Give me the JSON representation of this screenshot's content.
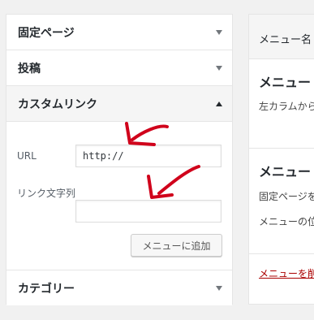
{
  "accordion": {
    "fixed_pages": "固定ページ",
    "posts": "投稿",
    "custom_link": "カスタムリンク",
    "categories": "カテゴリー"
  },
  "custom_link_panel": {
    "url_label": "URL",
    "url_value": "http://",
    "link_text_label": "リンク文字列",
    "link_text_value": "",
    "add_button": "メニューに追加"
  },
  "right_panel": {
    "menu_name_label": "メニュー名",
    "heading1": "メニュー⁠",
    "text1": "左カラムから",
    "heading2": "メニュー",
    "text2": "固定ページを",
    "text3": "メニューの位",
    "delete_link": "メニューを削"
  },
  "annotations": {
    "color": "#d0011b"
  }
}
